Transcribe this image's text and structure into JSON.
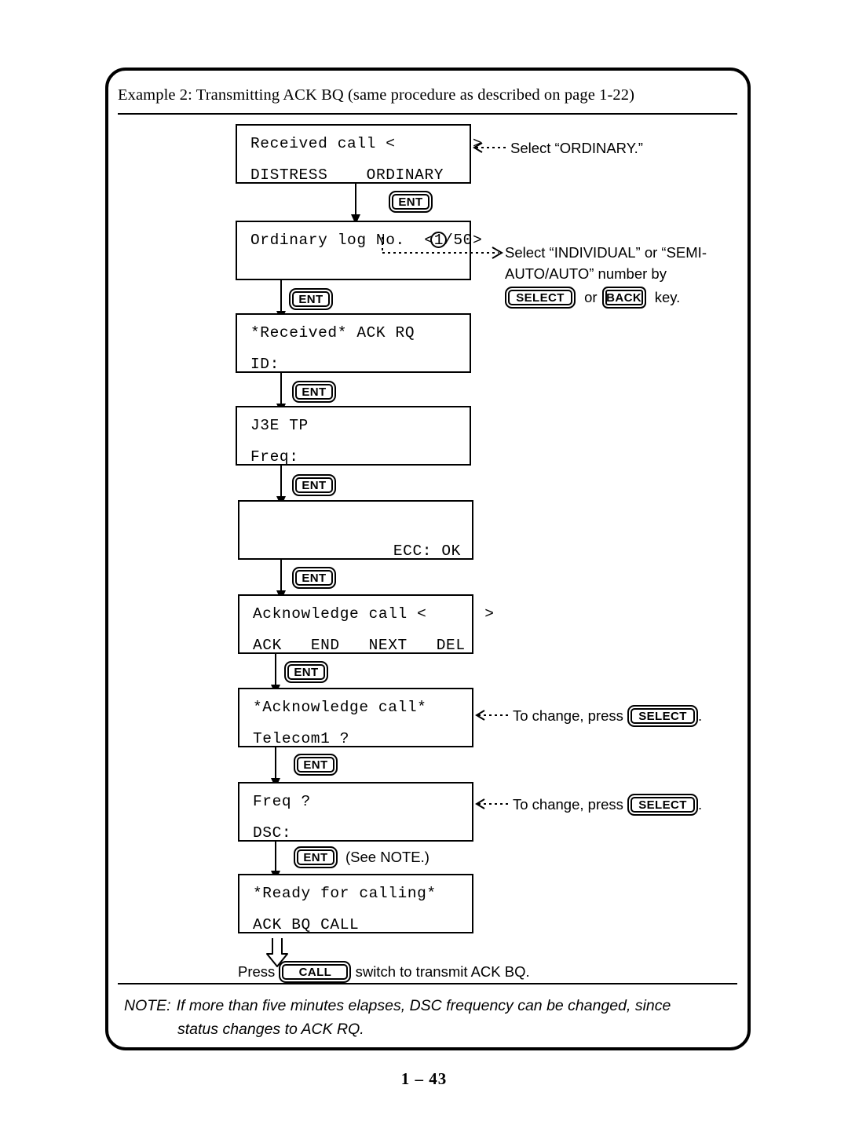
{
  "page": {
    "heading": "Example 2: Transmitting ACK BQ (same procedure as described on page 1-22)",
    "page_number": "1 – 43"
  },
  "keys": {
    "ent": "ENT",
    "select": "SELECT",
    "back": "BACK",
    "call": "CALL"
  },
  "screens": [
    {
      "id": "received-call",
      "line1": "Received call <        >",
      "line2_left": "DISTRESS",
      "line2_选": "ORDINARY"
    },
    {
      "id": "ordinary-log",
      "line1_prefix": "Ordinary log No.  <",
      "line1_circled": "1",
      "line1_suffix": "/50>"
    },
    {
      "id": "received-ack-rq",
      "line1": "*Received* ACK RQ",
      "line2": "ID:"
    },
    {
      "id": "j3e-tp",
      "line1": "J3E TP",
      "line2": "Freq:"
    },
    {
      "id": "ecc",
      "line2_right": "ECC: OK"
    },
    {
      "id": "acknowledge-call-menu",
      "line1": "Acknowledge call <      >",
      "menu_ack": "ACK",
      "menu_end": "END",
      "menu_next": "NEXT",
      "menu_del": "DEL"
    },
    {
      "id": "acknowledge-call",
      "line1": "*Acknowledge call*",
      "line2": "Telecom1 ?"
    },
    {
      "id": "freq",
      "line1": "Freq ?",
      "line2": "DSC:"
    },
    {
      "id": "ready-for-calling",
      "line1": "*Ready for calling*",
      "line2": "ACK BQ CALL"
    }
  ],
  "annotations": {
    "select_ordinary": "Select “ORDINARY.”",
    "select_individual_l1": "Select “INDIVIDUAL” or “SEMI-",
    "select_individual_l2": "AUTO/AUTO” number by",
    "select_individual_or": "or",
    "select_individual_key_suffix": "key.",
    "to_change_press_1": "To change, press",
    "to_change_press_1_end": ".",
    "to_change_press_2": "To change, press",
    "to_change_press_2_end": ".",
    "see_note": "(See NOTE.)",
    "press_call_prefix": "Press",
    "press_call_suffix": "switch to transmit ACK BQ."
  },
  "note": {
    "label": "NOTE:",
    "line1": "If more than five minutes elapses, DSC frequency can be changed, since",
    "line2": "status changes to ACK RQ."
  }
}
